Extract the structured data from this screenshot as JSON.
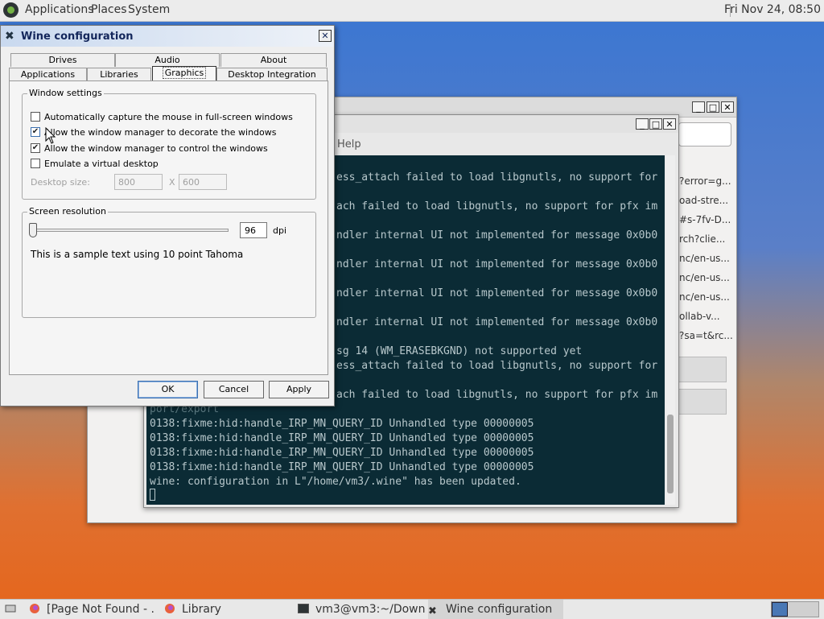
{
  "top_panel": {
    "menus": [
      "Applications",
      "Places",
      "System"
    ],
    "clock": "Fri Nov 24, 08:50"
  },
  "browser_window": {
    "links": [
      "?error=g...",
      "oad-stre...",
      "#s-7fv-D...",
      "rch?clie...",
      "nc/en-us...",
      "nc/en-us...",
      "nc/en-us...",
      "ollab-v...",
      "?sa=t&rc..."
    ]
  },
  "terminal": {
    "menu_help": "Help",
    "lines": [
      "ess_attach failed to load libgnutls, no support for",
      "ach failed to load libgnutls, no support for pfx im",
      "ndler internal UI not implemented for message 0x0b0",
      "ndler internal UI not implemented for message 0x0b0",
      "ndler internal UI not implemented for message 0x0b0",
      "ndler internal UI not implemented for message 0x0b0",
      "sg 14 (WM_ERASEBKGND) not supported yet",
      "ess_attach failed to load libgnutls, no support for",
      "ach failed to load libgnutls, no support for pfx im",
      "port/export",
      "0138:fixme:hid:handle_IRP_MN_QUERY_ID Unhandled type 00000005",
      "0138:fixme:hid:handle_IRP_MN_QUERY_ID Unhandled type 00000005",
      "0138:fixme:hid:handle_IRP_MN_QUERY_ID Unhandled type 00000005",
      "0138:fixme:hid:handle_IRP_MN_QUERY_ID Unhandled type 00000005",
      "wine: configuration in L\"/home/vm3/.wine\" has been updated."
    ]
  },
  "wine": {
    "title": "Wine configuration",
    "close": "✕",
    "tabs_row1": [
      "Drives",
      "Audio",
      "About"
    ],
    "tabs_row2": [
      "Applications",
      "Libraries",
      "Graphics",
      "Desktop Integration"
    ],
    "active_tab": "Graphics",
    "window_settings": {
      "legend": "Window settings",
      "options": [
        {
          "label": "Automatically capture the mouse in full-screen windows",
          "checked": false
        },
        {
          "label": "Allow the window manager to decorate the windows",
          "checked": true
        },
        {
          "label": "Allow the window manager to control the windows",
          "checked": true
        },
        {
          "label": "Emulate a virtual desktop",
          "checked": false
        }
      ],
      "desktop_size_label": "Desktop size:",
      "width": "800",
      "x": "X",
      "height": "600"
    },
    "screen_resolution": {
      "legend": "Screen resolution",
      "dpi_value": "96",
      "dpi_unit": "dpi",
      "sample_text": "This is a sample text using 10 point Tahoma"
    },
    "buttons": {
      "ok": "OK",
      "cancel": "Cancel",
      "apply": "Apply"
    }
  },
  "taskbar": {
    "tasks": [
      "[Page Not Found - ...",
      "Library",
      "vm3@vm3:~/Downl...",
      "Wine configuration"
    ]
  }
}
